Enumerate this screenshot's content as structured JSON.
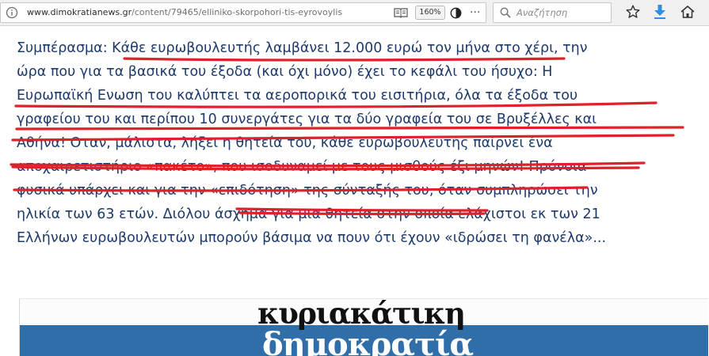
{
  "browser": {
    "url_prefix": "www.dimokratianews.gr",
    "url_path": "/content/79465/elliniko-skorpohori-tis-eyrovoylis",
    "zoom": "160%",
    "search_placeholder": "Αναζήτηση"
  },
  "article": {
    "lines": [
      "Συμπέρασμα: Κάθε ευρωβουλευτής λαμβάνει 12.000 ευρώ τον μήνα στο χέρι, την",
      "ώρα που για τα βασικά του έξοδα (και όχι μόνο) έχει το κεφάλι του ήσυχο: Η",
      "Ευρωπαϊκή Ενωση του καλύπτει τα αεροπορικά του εισιτήρια, όλα τα έξοδα του",
      "γραφείου του και περίπου 10 συνεργάτες για τα δύο γραφεία του σε Βρυξέλλες και",
      "Αθήνα! Οταν, μάλιστα, λήξει η θητεία του, κάθε ευρωβουλευτής παίρνει ένα",
      "αποχαιρετιστήριο «πακέτο», που ισοδυναμεί με τους μισθούς έξι μηνών! Πρόνοια",
      "φυσικά υπάρχει και για την «επιδότηση» της σύνταξής του, όταν συμπληρώσει την",
      "ηλικία των 63 ετών. Διόλου άσχημα για μια θητεία στην οποία ελάχιστοι εκ των 21",
      "Ελλήνων ευρωβουλευτών μπορούν βάσιμα να πουν ότι έχουν «ιδρώσει τη φανέλα»..."
    ],
    "annotation_color": "#e0202a",
    "text_color": "#1d3a6b"
  },
  "banner": {
    "line1": "κυριακάτικη",
    "line2": "δημοκρατία",
    "accent_color": "#2f6ea8"
  }
}
